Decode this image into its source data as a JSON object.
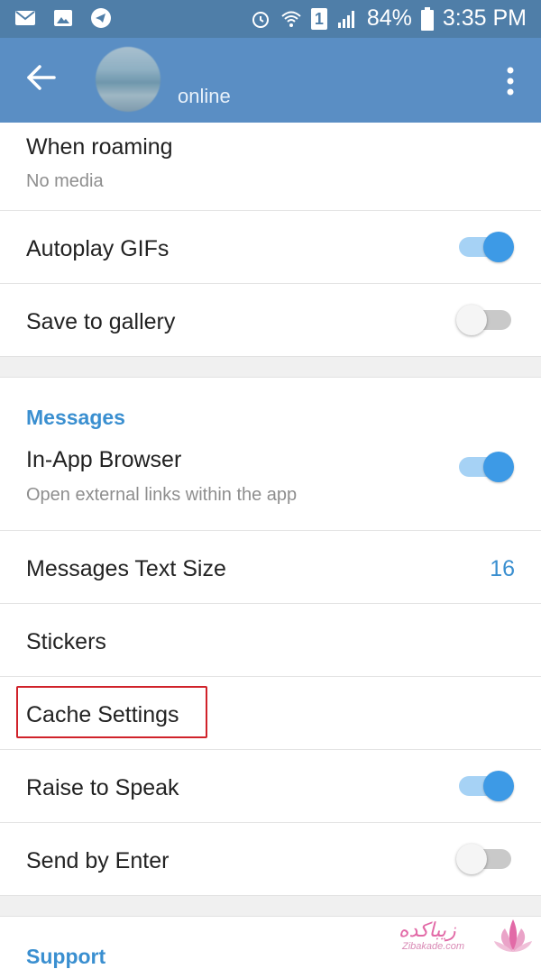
{
  "status_bar": {
    "left_icons": [
      "mail-icon",
      "image-icon",
      "telegram-icon"
    ],
    "right_icons": [
      "alarm-icon",
      "wifi-icon",
      "sim-icon",
      "signal-icon",
      "battery-icon"
    ],
    "sim_label": "1",
    "battery": "84%",
    "time": "3:35 PM"
  },
  "app_bar": {
    "status": "online",
    "color": "#5a8ec4"
  },
  "rows_top": [
    {
      "title": "When roaming",
      "subtitle": "No media"
    },
    {
      "title": "Autoplay GIFs",
      "switch": true
    },
    {
      "title": "Save to gallery",
      "switch": false
    }
  ],
  "messages_section": {
    "header": "Messages",
    "in_app_browser": {
      "title": "In-App Browser",
      "subtitle": "Open external links within the app",
      "switch": true
    },
    "text_size": {
      "title": "Messages Text Size",
      "value": "16"
    },
    "stickers": {
      "title": "Stickers"
    },
    "cache_settings": {
      "title": "Cache Settings"
    },
    "raise_to_speak": {
      "title": "Raise to Speak",
      "switch": true
    },
    "send_by_enter": {
      "title": "Send by Enter",
      "switch": false
    }
  },
  "support_section": {
    "header": "Support"
  },
  "watermark": {
    "text": "زیباکده",
    "sub": "Zibakade.com"
  },
  "colors": {
    "accent": "#3a8fd0",
    "highlight": "#d0222a"
  }
}
